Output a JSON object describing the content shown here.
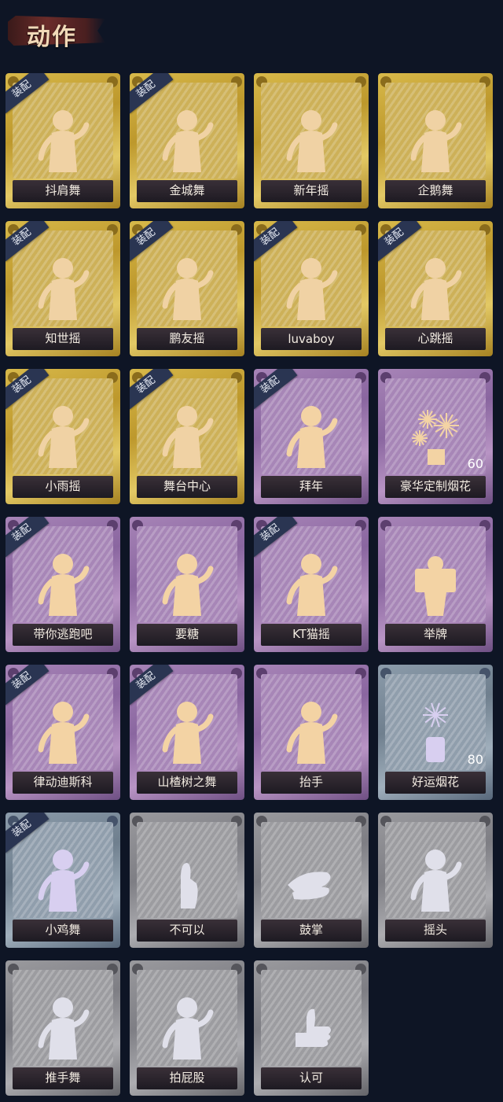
{
  "header": {
    "title": "动作"
  },
  "badge_label": "装配",
  "cards": [
    {
      "label": "抖肩舞",
      "tier": "gold",
      "equipped": true,
      "icon": "dancer-icon"
    },
    {
      "label": "金城舞",
      "tier": "gold",
      "equipped": true,
      "icon": "dancer-icon"
    },
    {
      "label": "新年摇",
      "tier": "gold",
      "equipped": false,
      "icon": "dancer-icon"
    },
    {
      "label": "企鹅舞",
      "tier": "gold",
      "equipped": false,
      "icon": "dancer-icon"
    },
    {
      "label": "知世摇",
      "tier": "gold",
      "equipped": true,
      "icon": "dancer-icon"
    },
    {
      "label": "鹏友摇",
      "tier": "gold",
      "equipped": true,
      "icon": "dancer-icon"
    },
    {
      "label": "luvaboy",
      "tier": "gold",
      "equipped": true,
      "icon": "dancer-icon"
    },
    {
      "label": "心跳摇",
      "tier": "gold",
      "equipped": true,
      "icon": "dancer-icon"
    },
    {
      "label": "小雨摇",
      "tier": "gold",
      "equipped": true,
      "icon": "dancer-icon"
    },
    {
      "label": "舞台中心",
      "tier": "gold",
      "equipped": true,
      "icon": "dancer-icon"
    },
    {
      "label": "拜年",
      "tier": "purple",
      "equipped": true,
      "icon": "bow-icon"
    },
    {
      "label": "豪华定制烟花",
      "tier": "purple",
      "equipped": false,
      "icon": "fireworks-icon",
      "count": "60"
    },
    {
      "label": "带你逃跑吧",
      "tier": "purple",
      "equipped": true,
      "icon": "dancer-icon"
    },
    {
      "label": "要糖",
      "tier": "purple",
      "equipped": false,
      "icon": "beg-icon"
    },
    {
      "label": "KT猫摇",
      "tier": "purple",
      "equipped": true,
      "icon": "dancer-icon"
    },
    {
      "label": "举牌",
      "tier": "purple",
      "equipped": false,
      "icon": "sign-icon"
    },
    {
      "label": "律动迪斯科",
      "tier": "purple",
      "equipped": true,
      "icon": "dancer-icon"
    },
    {
      "label": "山楂树之舞",
      "tier": "purple",
      "equipped": true,
      "icon": "dancer-icon"
    },
    {
      "label": "抬手",
      "tier": "purple",
      "equipped": false,
      "icon": "wave-icon"
    },
    {
      "label": "好运烟花",
      "tier": "blue",
      "equipped": false,
      "icon": "firecracker-icon",
      "count": "80"
    },
    {
      "label": "小鸡舞",
      "tier": "blue",
      "equipped": true,
      "icon": "dancer-icon"
    },
    {
      "label": "不可以",
      "tier": "gray",
      "equipped": false,
      "icon": "finger-wag-icon"
    },
    {
      "label": "鼓掌",
      "tier": "gray",
      "equipped": false,
      "icon": "clap-icon"
    },
    {
      "label": "摇头",
      "tier": "gray",
      "equipped": false,
      "icon": "head-shake-icon"
    },
    {
      "label": "推手舞",
      "tier": "gray",
      "equipped": false,
      "icon": "dancer-icon"
    },
    {
      "label": "拍屁股",
      "tier": "gray",
      "equipped": false,
      "icon": "dancer-icon"
    },
    {
      "label": "认可",
      "tier": "gray",
      "equipped": false,
      "icon": "thumbs-up-icon"
    }
  ],
  "colors": {
    "background": "#0e1525",
    "gold": "#d8b94a",
    "purple": "#a784b7",
    "blue": "#8c9cab",
    "gray": "#9a9a9e",
    "badge": "#2a3552"
  }
}
